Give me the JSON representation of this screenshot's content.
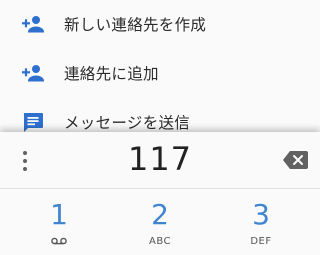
{
  "suggestions": {
    "items": [
      {
        "label": "新しい連絡先を作成",
        "icon": "person-add-icon"
      },
      {
        "label": "連絡先に追加",
        "icon": "person-add-icon"
      },
      {
        "label": "メッセージを送信",
        "icon": "message-icon"
      }
    ]
  },
  "dialpad": {
    "digits": "117",
    "overflow_icon": "more-vert-icon",
    "backspace_icon": "backspace-icon",
    "keys": [
      {
        "number": "1",
        "letters": "",
        "icon": "voicemail-icon"
      },
      {
        "number": "2",
        "letters": "ABC"
      },
      {
        "number": "3",
        "letters": "DEF"
      }
    ]
  },
  "colors": {
    "accent": "#3f85cf",
    "icon_blue": "#2f6fce",
    "background": "#fafafa",
    "text": "#212121"
  }
}
